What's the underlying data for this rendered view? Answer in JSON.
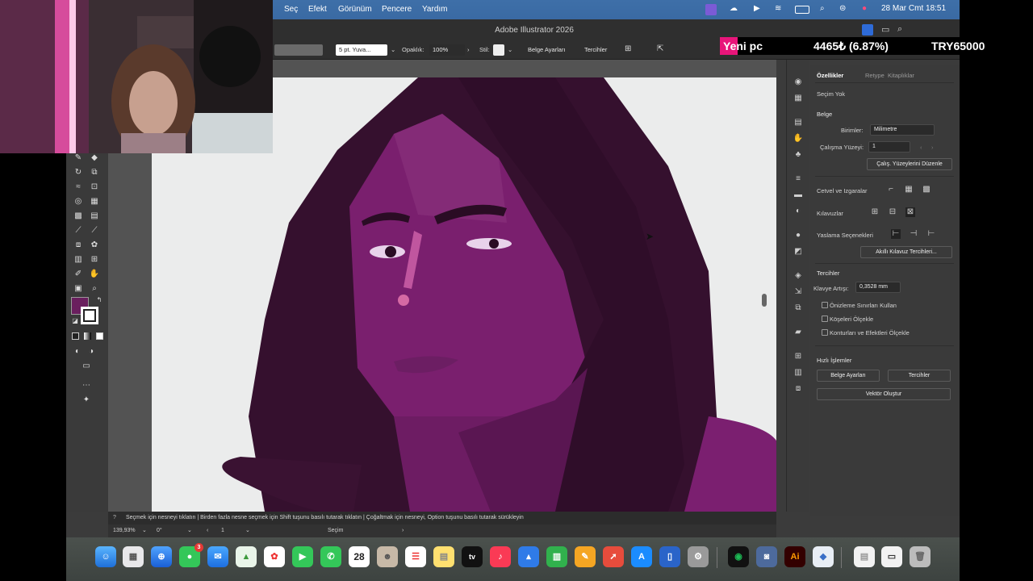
{
  "menubar": {
    "items": [
      "Seç",
      "Efekt",
      "Görünüm",
      "Pencere",
      "Yardım"
    ],
    "clock": "28 Mar Cmt  18:51"
  },
  "window": {
    "title": "Adobe Illustrator 2026"
  },
  "controlbar": {
    "stroke_weight": "5 pt. Yuva...",
    "opacity_label": "Opaklık:",
    "opacity_value": "100%",
    "style_label": "Stil:",
    "doc_setup_button": "Belge Ayarları",
    "prefs_button": "Tercihler"
  },
  "ticker": {
    "label": "Yeni pc",
    "price": "4465₺ (6.87%)",
    "goal": "TRY65000"
  },
  "properties": {
    "tabs": [
      "Özellikler",
      "Retype",
      "Kitaplıklar"
    ],
    "no_selection": "Seçim Yok",
    "document_heading": "Belge",
    "units_label": "Birimler:",
    "units_value": "Milimetre",
    "artboard_label": "Çalışma Yüzeyi:",
    "artboard_value": "1",
    "edit_artboards_button": "Çalış. Yüzeylerini Düzenle",
    "rulers_grids": "Cetvel ve Izgaralar",
    "guides": "Kılavuzlar",
    "snap_options": "Yaslama Seçenekleri",
    "smart_guides_button": "Akıllı Kılavuz Tercihleri...",
    "preferences_heading": "Tercihler",
    "key_increment_label": "Klavye Artışı:",
    "key_increment_value": "0,3528 mm",
    "checkboxes": [
      "Önizleme Sınırları Kullan",
      "Köşeleri Ölçekle",
      "Konturları ve Efektleri Ölçekle"
    ],
    "quick_actions_heading": "Hızlı İşlemler",
    "doc_setup_button": "Belge Ayarları",
    "prefs_button": "Tercihler",
    "vector_button": "Vektör Oluştur"
  },
  "hintbar": {
    "text": "Seçmek için nesneyi tıklatın  |  Birden fazla nesne seçmek için Shift tuşunu basılı tutarak tıklatın  |  Çoğaltmak için nesneyi, Option tuşunu basılı tutarak sürükleyin"
  },
  "statusbar": {
    "zoom": "139,93%",
    "rotation": "0°",
    "artboard": "1",
    "tool": "Seçim"
  },
  "dock": {
    "calendar_day": "28",
    "mail_badge": "3",
    "illustrator_label": "Ai",
    "apple_tv_label": "tv"
  },
  "colors": {
    "fill": "#6a1f5e",
    "hair": "#2e0f2a",
    "skin": "#7a1f6e",
    "accent_menubar": "#3e6fa8"
  }
}
